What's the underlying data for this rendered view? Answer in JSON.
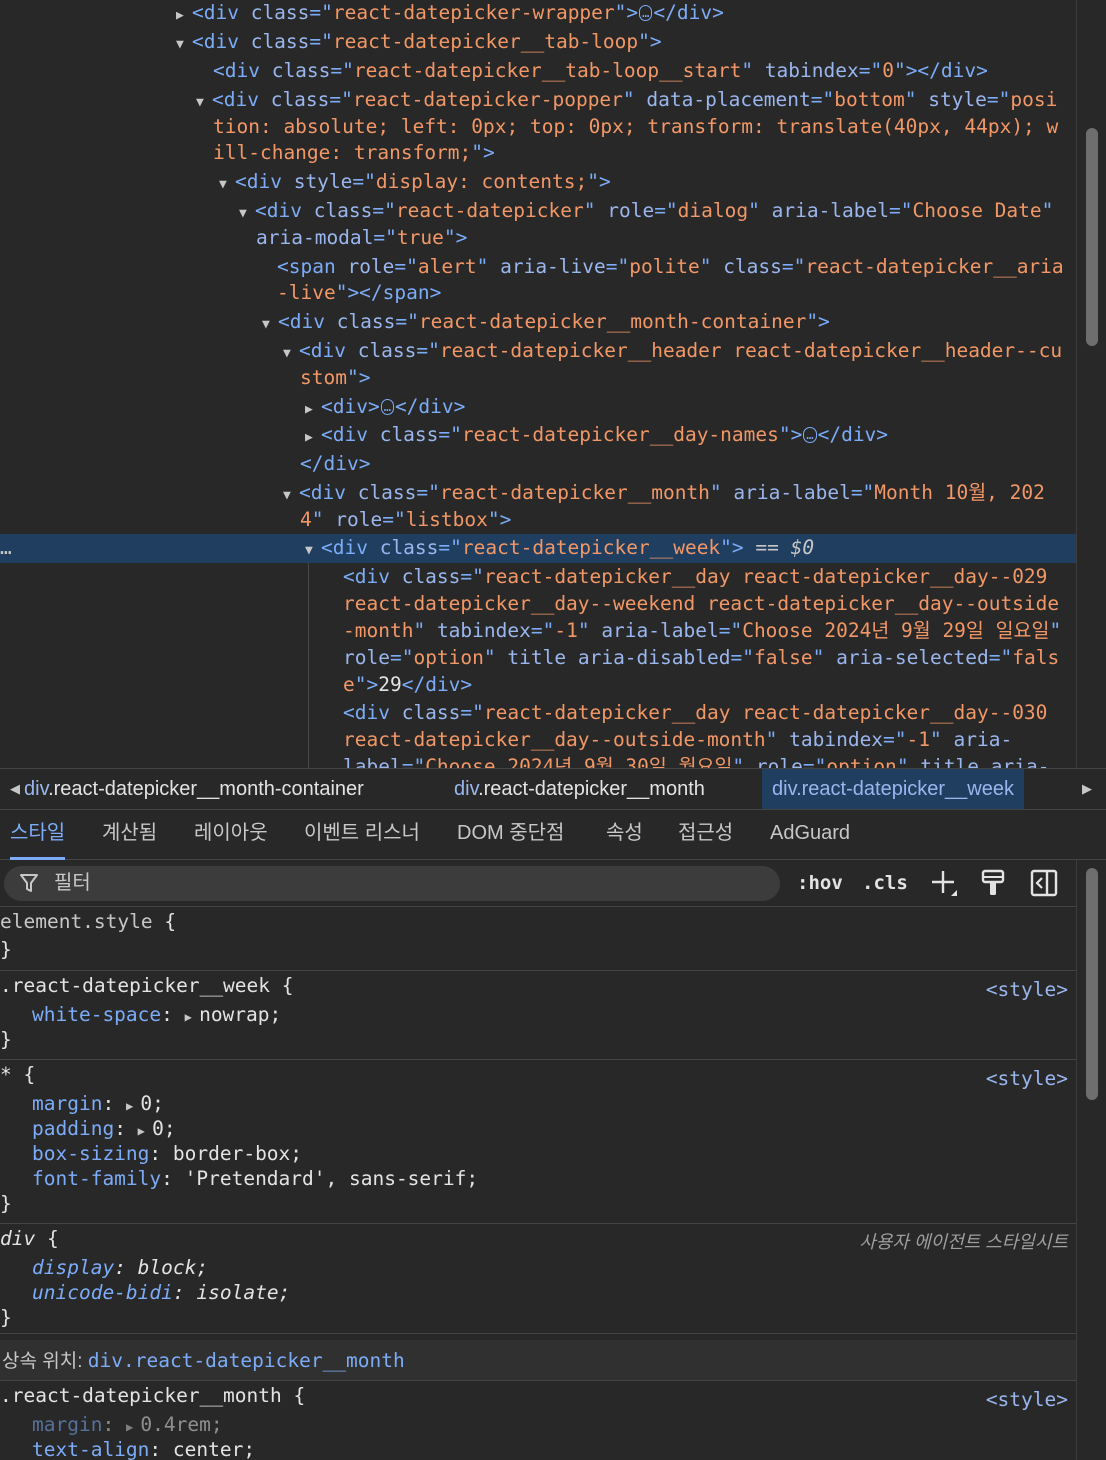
{
  "tree": {
    "lines": [
      {
        "parts": [
          [
            "tri",
            "▶"
          ],
          [
            "tg",
            "<div "
          ],
          [
            "at",
            "class"
          ],
          [
            "tg",
            "=\""
          ],
          [
            "av",
            "react-datepicker-wrapper"
          ],
          [
            "tg",
            "\">"
          ],
          [
            "ell",
            "…"
          ],
          [
            "tg",
            "</div>"
          ]
        ]
      },
      {
        "parts": [
          [
            "tri",
            "▼"
          ],
          [
            "tg",
            "<div "
          ],
          [
            "at",
            "class"
          ],
          [
            "tg",
            "=\""
          ],
          [
            "av",
            "react-datepicker__tab-loop"
          ],
          [
            "tg",
            "\">"
          ]
        ]
      },
      {
        "parts": [
          [
            "tg",
            "<div "
          ],
          [
            "at",
            "class"
          ],
          [
            "tg",
            "=\""
          ],
          [
            "av",
            "react-datepicker__tab-loop__start"
          ],
          [
            "tg",
            "\" "
          ],
          [
            "at",
            "tabindex"
          ],
          [
            "tg",
            "=\""
          ],
          [
            "av",
            "0"
          ],
          [
            "tg",
            "\"></div>"
          ]
        ]
      },
      {
        "parts": [
          [
            "tri",
            "▼"
          ],
          [
            "tg",
            "<div "
          ],
          [
            "at",
            "class"
          ],
          [
            "tg",
            "=\""
          ],
          [
            "av",
            "react-datepicker-popper"
          ],
          [
            "tg",
            "\" "
          ],
          [
            "at",
            "data-placement"
          ],
          [
            "tg",
            "=\""
          ],
          [
            "av",
            "bottom"
          ],
          [
            "tg",
            "\" "
          ],
          [
            "at",
            "style"
          ],
          [
            "tg",
            "=\""
          ],
          [
            "av",
            "posi"
          ]
        ]
      },
      {
        "parts": [
          [
            "av",
            "tion: absolute; left: 0px; top: 0px; transform: translate(40px, 44px); w"
          ]
        ]
      },
      {
        "parts": [
          [
            "av",
            "ill-change: transform;"
          ],
          [
            "tg",
            "\">"
          ]
        ]
      },
      {
        "parts": [
          [
            "tri",
            "▼"
          ],
          [
            "tg",
            "<div "
          ],
          [
            "at",
            "style"
          ],
          [
            "tg",
            "=\""
          ],
          [
            "av",
            "display: contents;"
          ],
          [
            "tg",
            "\">"
          ]
        ]
      },
      {
        "parts": [
          [
            "tri",
            "▼"
          ],
          [
            "tg",
            "<div "
          ],
          [
            "at",
            "class"
          ],
          [
            "tg",
            "=\""
          ],
          [
            "av",
            "react-datepicker"
          ],
          [
            "tg",
            "\" "
          ],
          [
            "at",
            "role"
          ],
          [
            "tg",
            "=\""
          ],
          [
            "av",
            "dialog"
          ],
          [
            "tg",
            "\" "
          ],
          [
            "at",
            "aria-label"
          ],
          [
            "tg",
            "=\""
          ],
          [
            "av",
            "Choose Date"
          ],
          [
            "tg",
            "\""
          ]
        ]
      },
      {
        "parts": [
          [
            "at",
            "aria-modal"
          ],
          [
            "tg",
            "=\""
          ],
          [
            "av",
            "true"
          ],
          [
            "tg",
            "\">"
          ]
        ]
      },
      {
        "parts": [
          [
            "tg",
            "<span "
          ],
          [
            "at",
            "role"
          ],
          [
            "tg",
            "=\""
          ],
          [
            "av",
            "alert"
          ],
          [
            "tg",
            "\" "
          ],
          [
            "at",
            "aria-live"
          ],
          [
            "tg",
            "=\""
          ],
          [
            "av",
            "polite"
          ],
          [
            "tg",
            "\" "
          ],
          [
            "at",
            "class"
          ],
          [
            "tg",
            "=\""
          ],
          [
            "av",
            "react-datepicker__aria"
          ]
        ]
      },
      {
        "parts": [
          [
            "av",
            "-live"
          ],
          [
            "tg",
            "\"></span>"
          ]
        ]
      },
      {
        "parts": [
          [
            "tri",
            "▼"
          ],
          [
            "tg",
            "<div "
          ],
          [
            "at",
            "class"
          ],
          [
            "tg",
            "=\""
          ],
          [
            "av",
            "react-datepicker__month-container"
          ],
          [
            "tg",
            "\">"
          ]
        ]
      },
      {
        "parts": [
          [
            "tri",
            "▼"
          ],
          [
            "tg",
            "<div "
          ],
          [
            "at",
            "class"
          ],
          [
            "tg",
            "=\""
          ],
          [
            "av",
            "react-datepicker__header react-datepicker__header--cu"
          ]
        ]
      },
      {
        "parts": [
          [
            "av",
            "stom"
          ],
          [
            "tg",
            "\">"
          ]
        ]
      },
      {
        "parts": [
          [
            "tri",
            "▶"
          ],
          [
            "tg",
            "<div>"
          ],
          [
            "ell",
            "…"
          ],
          [
            "tg",
            "</div>"
          ]
        ]
      },
      {
        "parts": [
          [
            "tri",
            "▶"
          ],
          [
            "tg",
            "<div "
          ],
          [
            "at",
            "class"
          ],
          [
            "tg",
            "=\""
          ],
          [
            "av",
            "react-datepicker__day-names"
          ],
          [
            "tg",
            "\">"
          ],
          [
            "ell",
            "…"
          ],
          [
            "tg",
            "</div>"
          ]
        ]
      },
      {
        "parts": [
          [
            "tg",
            "</div>"
          ]
        ]
      },
      {
        "parts": [
          [
            "tri",
            "▼"
          ],
          [
            "tg",
            "<div "
          ],
          [
            "at",
            "class"
          ],
          [
            "tg",
            "=\""
          ],
          [
            "av",
            "react-datepicker__month"
          ],
          [
            "tg",
            "\" "
          ],
          [
            "at",
            "aria-label"
          ],
          [
            "tg",
            "=\""
          ],
          [
            "av",
            "Month 10월, 202"
          ]
        ]
      },
      {
        "parts": [
          [
            "av",
            "4"
          ],
          [
            "tg",
            "\" "
          ],
          [
            "at",
            "role"
          ],
          [
            "tg",
            "=\""
          ],
          [
            "av",
            "listbox"
          ],
          [
            "tg",
            "\">"
          ]
        ]
      },
      {
        "parts": [
          [
            "tri",
            "▼"
          ],
          [
            "tg",
            "<div "
          ],
          [
            "at",
            "class"
          ],
          [
            "tg",
            "=\""
          ],
          [
            "av",
            "react-datepicker__week"
          ],
          [
            "tg",
            "\">"
          ],
          [
            "eqd",
            " == "
          ],
          [
            "dollar",
            "$0"
          ]
        ]
      },
      {
        "parts": [
          [
            "tg",
            "<div "
          ],
          [
            "at",
            "class"
          ],
          [
            "tg",
            "=\""
          ],
          [
            "av",
            "react-datepicker__day react-datepicker__day--029"
          ]
        ]
      },
      {
        "parts": [
          [
            "av",
            "react-datepicker__day--weekend react-datepicker__day--outside"
          ]
        ]
      },
      {
        "parts": [
          [
            "av",
            "-month"
          ],
          [
            "tg",
            "\" "
          ],
          [
            "at",
            "tabindex"
          ],
          [
            "tg",
            "=\""
          ],
          [
            "av",
            "-1"
          ],
          [
            "tg",
            "\" "
          ],
          [
            "at",
            "aria-label"
          ],
          [
            "tg",
            "=\""
          ],
          [
            "av",
            "Choose 2024년 9월 29일 일요일"
          ],
          [
            "tg",
            "\""
          ]
        ]
      },
      {
        "parts": [
          [
            "at",
            "role"
          ],
          [
            "tg",
            "=\""
          ],
          [
            "av",
            "option"
          ],
          [
            "tg",
            "\" "
          ],
          [
            "at",
            "title "
          ],
          [
            "at",
            "aria-disabled"
          ],
          [
            "tg",
            "=\""
          ],
          [
            "av",
            "false"
          ],
          [
            "tg",
            "\" "
          ],
          [
            "at",
            "aria-selected"
          ],
          [
            "tg",
            "=\""
          ],
          [
            "av",
            "fals"
          ]
        ]
      },
      {
        "parts": [
          [
            "av",
            "e"
          ],
          [
            "tg",
            "\">"
          ],
          [
            "tx",
            "29"
          ],
          [
            "tg",
            "</div>"
          ]
        ]
      },
      {
        "parts": [
          [
            "tg",
            "<div "
          ],
          [
            "at",
            "class"
          ],
          [
            "tg",
            "=\""
          ],
          [
            "av",
            "react-datepicker__day react-datepicker__day--030"
          ]
        ]
      },
      {
        "parts": [
          [
            "av",
            "react-datepicker__day--outside-month"
          ],
          [
            "tg",
            "\" "
          ],
          [
            "at",
            "tabindex"
          ],
          [
            "tg",
            "=\""
          ],
          [
            "av",
            "-1"
          ],
          [
            "tg",
            "\" "
          ],
          [
            "at",
            "aria-"
          ]
        ]
      },
      {
        "parts": [
          [
            "at",
            "label"
          ],
          [
            "tg",
            "=\""
          ],
          [
            "av",
            "Choose 2024년 9월 30일 월요일"
          ],
          [
            "tg",
            "\" "
          ],
          [
            "at",
            "role"
          ],
          [
            "tg",
            "=\""
          ],
          [
            "av",
            "option"
          ],
          [
            "tg",
            "\" "
          ],
          [
            "at",
            "title "
          ],
          [
            "at",
            "aria-"
          ]
        ]
      }
    ],
    "selected_marker": "…"
  },
  "breadcrumbs": [
    {
      "el": "div",
      "cls": ".react-datepicker__month-container",
      "clipped": true
    },
    {
      "el": "div",
      "cls": ".react-datepicker__month"
    },
    {
      "el": "div",
      "cls": ".react-datepicker__week",
      "active": true
    }
  ],
  "tabs": [
    "스타일",
    "계산됨",
    "레이아웃",
    "이벤트 리스너",
    "DOM 중단점",
    "속성",
    "접근성",
    "AdGuard"
  ],
  "active_tab": "스타일",
  "filter": {
    "placeholder": "필터",
    "value": ""
  },
  "toolbar": {
    "hov": ":hov",
    "cls": ".cls"
  },
  "icons": [
    "filter-icon",
    "plus-icon",
    "paint-brush-icon",
    "sidebar-toggle-icon"
  ],
  "rules": [
    {
      "selector": "element.style",
      "open": " {",
      "close": "}",
      "source": "",
      "decls": []
    },
    {
      "selector": ".react-datepicker__week",
      "open": " {",
      "close": "}",
      "source": "<style>",
      "decls": [
        {
          "prop": "white-space",
          "val": "nowrap",
          "expand": true
        }
      ]
    },
    {
      "selector": "*",
      "open": " {",
      "close": "}",
      "source": "<style>",
      "decls": [
        {
          "prop": "margin",
          "val": "0",
          "expand": true
        },
        {
          "prop": "padding",
          "val": "0",
          "expand": true
        },
        {
          "prop": "box-sizing",
          "val": "border-box"
        },
        {
          "prop": "font-family",
          "val": "'Pretendard', sans-serif"
        }
      ]
    },
    {
      "selector": "div",
      "open": " {",
      "close": "}",
      "source": "사용자 에이전트 스타일시트",
      "ua": true,
      "decls": [
        {
          "prop": "display",
          "val": "block"
        },
        {
          "prop": "unicode-bidi",
          "val": "isolate"
        }
      ]
    }
  ],
  "inherited": {
    "label": "상속 위치: ",
    "target": "div.react-datepicker__month"
  },
  "inherited_rule": {
    "selector": ".react-datepicker__month",
    "open": " {",
    "source": "<style>",
    "decls": [
      {
        "prop": "margin",
        "val": "0.4rem",
        "expand": true,
        "dim": true
      },
      {
        "prop": "text-align",
        "val": "center"
      }
    ]
  }
}
